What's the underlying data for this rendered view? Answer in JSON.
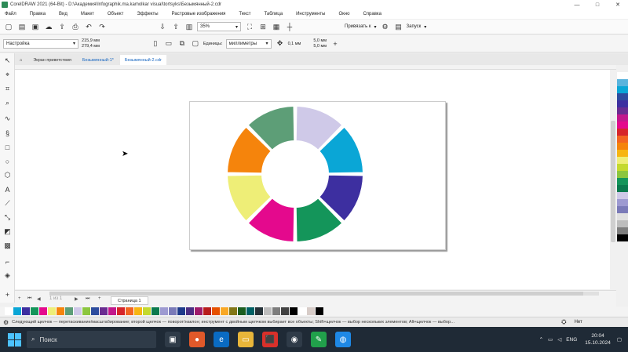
{
  "window": {
    "title": "CorelDRAW 2021 (64-Bit) - D:\\Академия\\Infographik.ma.kamolkar visual\\tortsyks\\Безымянный-2.cdr",
    "controls": [
      "—",
      "□",
      "✕"
    ]
  },
  "menu": [
    "Файл",
    "Правка",
    "Вид",
    "Макет",
    "Объект",
    "Эффекты",
    "Растровые изображения",
    "Текст",
    "Таблица",
    "Инструменты",
    "Окно",
    "Справка"
  ],
  "toolbar1": {
    "zoom": "35%",
    "snap_label": "Привязать к",
    "launch_label": "Запуск"
  },
  "toolbar2": {
    "preset": "Настройка",
    "width": "215,9 мм",
    "height": "279,4 мм",
    "units_label": "Единицы:",
    "units_value": "миллиметры",
    "nudge": "0,1 мм",
    "dup_x": "5,0 мм",
    "dup_y": "5,0 мм"
  },
  "tabs": {
    "welcome": "Экран приветствия",
    "doc1": "Безымянный-1*",
    "doc2": "Безымянный-2.cdr"
  },
  "pagebar": {
    "page_counter": "1 из 1",
    "page_tab": "Страница 1"
  },
  "status": {
    "text": "Следующий щелчок — перетаскивание/масштабирование; второй щелчок — поворот/наклон; инструмент с двойным щелчком выбирает все объекты; Shift+щелчок — выбор нескольких элементов; Alt+щелчок — выбор…",
    "fill_label": "Нет"
  },
  "taskbar": {
    "search_placeholder": "Поиск",
    "lang": "ENG",
    "time": "20:04",
    "date": "15.10.2024"
  },
  "colors": {
    "wheel": [
      "#cfc9e8",
      "#0aa6d6",
      "#3d2fa0",
      "#14955a",
      "#e4098d",
      "#eeee77",
      "#f5840c",
      "#5d9e77"
    ],
    "side_palette": [
      "#ffffff",
      "#5ab4dd",
      "#0aa6d6",
      "#2d4c9e",
      "#3d2fa0",
      "#6a2c91",
      "#c2188c",
      "#e4098d",
      "#d6252b",
      "#f26522",
      "#f5840c",
      "#f7b512",
      "#eeee77",
      "#c4d92e",
      "#8cc63f",
      "#14955a",
      "#0b7a4e",
      "#cfc9e8",
      "#9d9ad1",
      "#7a7ab8",
      "#e0e0e0",
      "#bdbdbd",
      "#7d7d7d",
      "#000000"
    ],
    "doc_palette": [
      "#ffffff",
      "#0aa6d6",
      "#3d2fa0",
      "#14955a",
      "#e4098d",
      "#eeee77",
      "#f5840c",
      "#5d9e77",
      "#cfc9e8",
      "#8cc63f",
      "#2d4c9e",
      "#6a2c91",
      "#c2188c",
      "#d6252b",
      "#f26522",
      "#f7b512",
      "#c4d92e",
      "#0b7a4e",
      "#9d9ad1",
      "#7a7ab8",
      "#1e3a8a",
      "#4b2e83",
      "#9e1b6b",
      "#b71c1c",
      "#e65100",
      "#f9a825",
      "#827717",
      "#1b5e20",
      "#006064",
      "#263238",
      "#bdbdbd",
      "#7d7d7d",
      "#424242",
      "#000000",
      "#ffffff",
      "#d7ccc8",
      "#000000"
    ]
  }
}
